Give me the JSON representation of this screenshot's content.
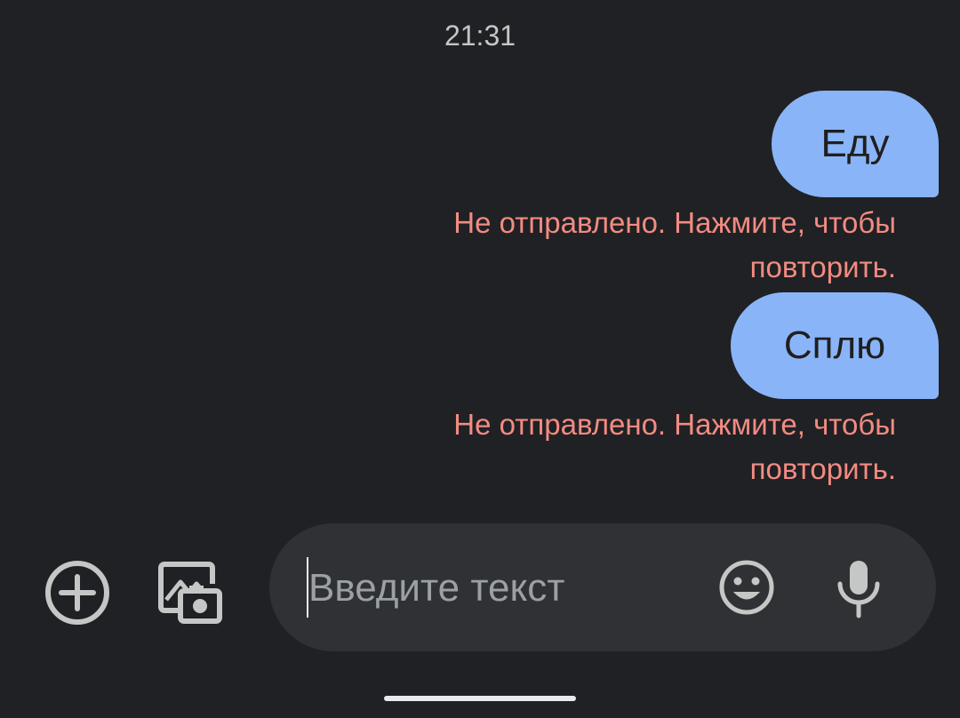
{
  "status": {
    "timestamp": "21:31"
  },
  "messages": [
    {
      "text": "Еду",
      "error": "Не отправлено. Нажмите, чтобы повторить."
    },
    {
      "text": "Сплю",
      "error": "Не отправлено. Нажмите, чтобы повторить."
    }
  ],
  "composer": {
    "placeholder": "Введите текст",
    "value": ""
  },
  "icons": {
    "add": "add-circle-icon",
    "gallery": "gallery-camera-icon",
    "emoji": "emoji-icon",
    "mic": "mic-icon"
  },
  "colors": {
    "background": "#202124",
    "outgoing_bubble": "#8ab4f8",
    "error_text": "#f28b82",
    "composer_bg": "#303134"
  }
}
